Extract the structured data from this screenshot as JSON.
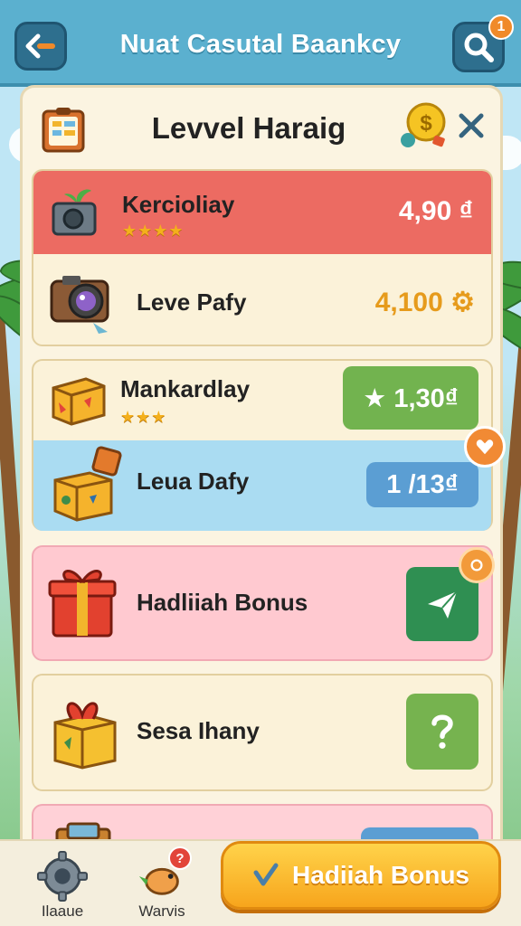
{
  "header": {
    "title": "Nuat Casutal Baankcy",
    "notification_count": "1",
    "back_icon": "back-arrow-icon",
    "search_icon": "search-icon"
  },
  "panel": {
    "title": "Levvel Haraig",
    "close_icon": "close-icon",
    "coin_icon": "coin-icon"
  },
  "levels": [
    {
      "name": "Kercioliay",
      "stars": "★★★★",
      "price": "4,90 ₫",
      "icon": "camera-plant-icon",
      "color": "#ec6b62"
    },
    {
      "name": "Leve Pafy",
      "price": "4,100 ⚙",
      "icon": "camera-icon",
      "color": "#e69b1c"
    },
    {
      "name": "Mankardlay",
      "stars": "★★★",
      "price": "★ 1,30₫",
      "icon": "box-icon",
      "color": "#72b34f"
    },
    {
      "name": "Leua Dafy",
      "price": "1 /13₫",
      "icon": "open-box-icon",
      "color": "#5b9ed3"
    },
    {
      "name": "Hadliiah Bonus",
      "icon": "gift-icon",
      "action_icon": "paper-plane-icon",
      "color": "#2f8f52"
    },
    {
      "name": "Sesa Ihany",
      "icon": "gift-box-icon",
      "action_icon": "question-icon",
      "color": "#76b34f"
    }
  ],
  "bottom_nav": {
    "item1_label": "Ilaaue",
    "item1_icon": "gear-icon",
    "item2_label": "Warvis",
    "item2_icon": "bird-icon",
    "item2_badge": "?",
    "bonus_button": "Hadiiah Bonus",
    "bonus_icon": "check-icon"
  }
}
